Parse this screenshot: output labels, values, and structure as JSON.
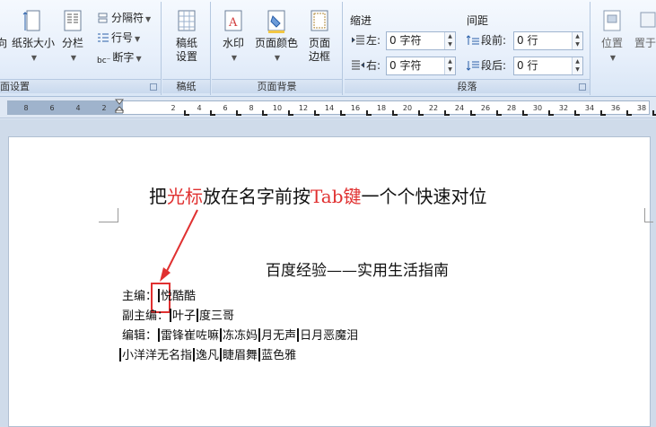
{
  "ribbon": {
    "page_setup": {
      "cut_label": "向",
      "paper_size": "纸张大小",
      "columns": "分栏",
      "breaks": "分隔符",
      "line_numbers": "行号",
      "hyphenation": "断字",
      "group_label": "面设置"
    },
    "manuscript": {
      "button": "稿纸设置",
      "button_line1": "稿纸",
      "button_line2": "设置",
      "group_label": "稿纸"
    },
    "page_background": {
      "watermark": "水印",
      "page_color": "页面颜色",
      "page_borders_line1": "页面",
      "page_borders_line2": "边框",
      "group_label": "页面背景"
    },
    "paragraph": {
      "indent_title": "缩进",
      "spacing_title": "间距",
      "indent_left_label": "左:",
      "indent_left_value": "0 字符",
      "indent_right_label": "右:",
      "indent_right_value": "0 字符",
      "spacing_before_label": "段前:",
      "spacing_before_value": "0 行",
      "spacing_after_label": "段后:",
      "spacing_after_value": "0 行",
      "group_label": "段落"
    },
    "arrange": {
      "position": "位置",
      "wrap_cut": "置于"
    }
  },
  "ruler": {
    "labels": [
      "8",
      "6",
      "4",
      "2",
      "2",
      "4",
      "6",
      "8",
      "10",
      "12",
      "14",
      "16",
      "18",
      "20",
      "22",
      "24",
      "26",
      "28",
      "30",
      "32",
      "34",
      "36",
      "38"
    ]
  },
  "document": {
    "annotation_part1": "把",
    "annotation_red1": "光标",
    "annotation_part2": "放在名字前按",
    "annotation_red2": "Tab键",
    "annotation_part3": "一个个快速对位",
    "title": "百度经验——实用生活指南",
    "line1_label": "主编：",
    "line1_names": [
      "悦酷酷"
    ],
    "line2_label": "副主编：",
    "line2_names": [
      "叶子",
      "度三哥"
    ],
    "line3_label": "编辑：",
    "line3_names": [
      "雷锋崔",
      "咗嘛",
      "冻冻妈",
      "月无声",
      "日月",
      "恶魔泪"
    ],
    "line4_names": [
      "小洋洋",
      "无名指",
      "逸凡",
      "睫眉舞",
      "蓝色雅"
    ]
  },
  "colors": {
    "accent_red": "#e03030",
    "ribbon_bg": "#e8f0fb"
  }
}
